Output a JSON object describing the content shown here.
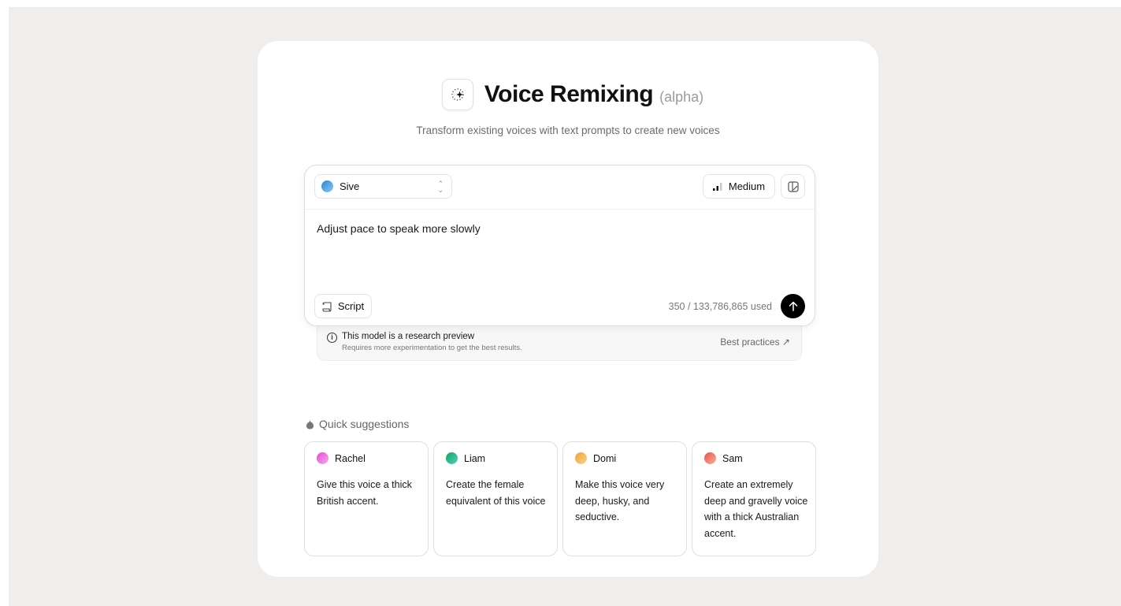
{
  "header": {
    "title": "Voice Remixing",
    "badge": "(alpha)",
    "subtitle": "Transform existing voices with text prompts to create new voices",
    "icon": "sparkle-dotted-circle-icon"
  },
  "editor": {
    "voice": {
      "name": "Sive",
      "colors": [
        "#2f7fd6",
        "#7fd0f0"
      ]
    },
    "model_label": "Medium",
    "prompt_value": "Adjust pace to speak more slowly",
    "script_label": "Script",
    "usage": "350 / 133,786,865 used"
  },
  "notice": {
    "title": "This model is a research preview",
    "subtitle": "Requires more experimentation to get the best results.",
    "link": "Best practices ↗"
  },
  "suggestions": {
    "header": "Quick suggestions",
    "items": [
      {
        "name": "Rachel",
        "text": "Give this voice a thick British accent.",
        "colors": [
          "#e64bd6",
          "#f6a6e8"
        ]
      },
      {
        "name": "Liam",
        "text": "Create the female equivalent of this voice",
        "colors": [
          "#12a35a",
          "#4fd0c8"
        ]
      },
      {
        "name": "Domi",
        "text": "Make this voice very deep, husky, and seductive.",
        "colors": [
          "#f0a030",
          "#f7d78a"
        ]
      },
      {
        "name": "Sam",
        "text": "Create an extremely deep and gravelly voice with a thick Australian accent.",
        "colors": [
          "#e8504a",
          "#f6b39c"
        ]
      }
    ]
  }
}
